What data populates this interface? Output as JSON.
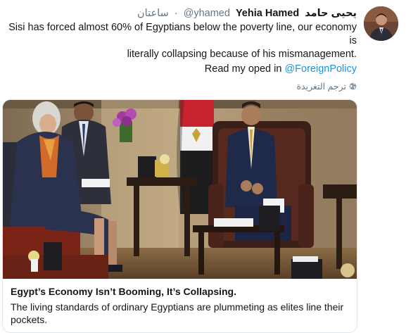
{
  "tweet": {
    "author_name_ar": "يحيى حامد",
    "author_name_en": "Yehia Hamed",
    "handle": "@yhamed",
    "separator": "·",
    "time": "ساعتان",
    "text_line1": "Sisi has forced almost 60% of Egyptians below the poverty line, our economy is",
    "text_line2": "literally collapsing because of his mismanagement.",
    "oped_prefix": "Read my oped in ",
    "oped_link": "@ForeignPolicy",
    "translate_label": "ترجم التغريدة",
    "icons": {
      "avatar": "avatar",
      "globe": "globe-icon"
    },
    "colors": {
      "link": "#1b95e0",
      "muted": "#657786",
      "text": "#14171a",
      "border": "#e1e8ed"
    }
  },
  "card": {
    "title": "Egypt’s Economy Isn’t Booming, It’s Collapsing.",
    "description": "The living standards of ordinary Egyptians are plummeting as elites line their pockets.",
    "image": "photo of a meeting between a woman and Egyptian officials seated in armchairs with Egyptian flag"
  }
}
